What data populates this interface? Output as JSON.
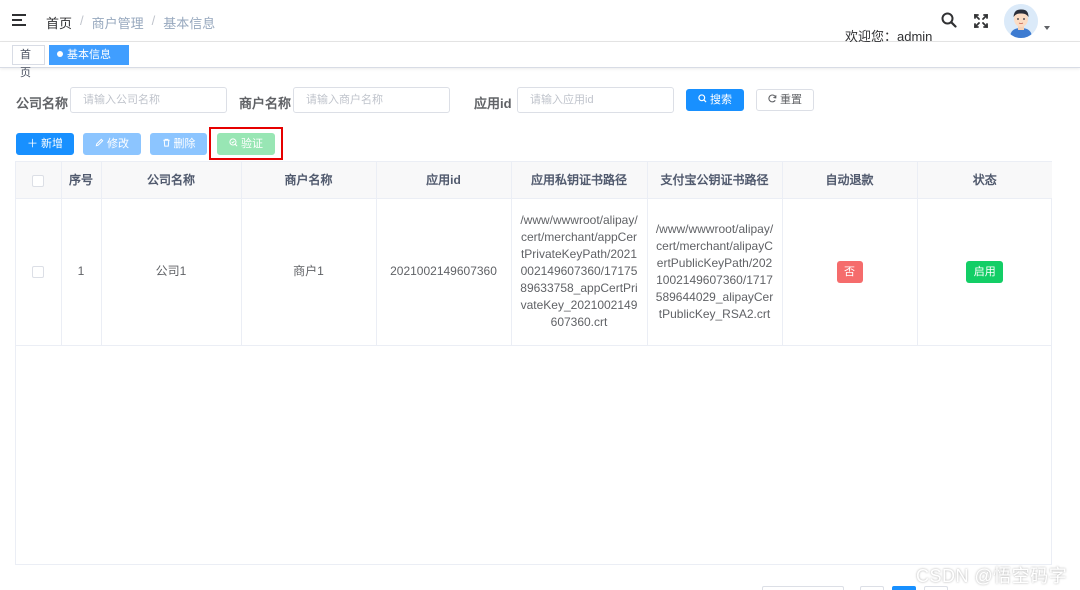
{
  "header": {
    "breadcrumb": [
      "首页",
      "商户管理",
      "基本信息"
    ],
    "separator": "/",
    "welcome": "欢迎您：admin"
  },
  "tags": [
    {
      "label": "首页",
      "active": false
    },
    {
      "label": "基本信息",
      "active": true,
      "close": "×"
    }
  ],
  "search": {
    "company_label": "公司名称",
    "company_placeholder": "请输入公司名称",
    "merchant_label": "商户名称",
    "merchant_placeholder": "请输入商户名称",
    "appid_label": "应用id",
    "appid_placeholder": "请输入应用id",
    "search_button": "搜索",
    "reset_button": "重置"
  },
  "toolbar": {
    "add": "新增",
    "edit": "修改",
    "delete": "删除",
    "verify": "验证"
  },
  "table": {
    "columns": [
      "序号",
      "公司名称",
      "商户名称",
      "应用id",
      "应用私钥证书路径",
      "支付宝公钥证书路径",
      "自动退款",
      "状态"
    ],
    "rows": [
      {
        "index": "1",
        "company": "公司1",
        "merchant": "商户1",
        "app_id": "2021002149607360",
        "private_key_path": "/www/wwwroot/alipay/cert/merchant/appCertPrivateKeyPath/2021002149607360/1717589633758_appCertPrivateKey_2021002149607360.crt",
        "public_key_path": "/www/wwwroot/alipay/cert/merchant/alipayCertPublicKeyPath/2021002149607360/1717589644029_alipayCertPublicKey_RSA2.crt",
        "auto_refund": "否",
        "status": "启用"
      }
    ]
  },
  "watermark": "CSDN @悟空码字",
  "colors": {
    "primary": "#1890ff",
    "danger": "#f56c6c",
    "success": "#13ce66",
    "highlight": "#e60000"
  }
}
